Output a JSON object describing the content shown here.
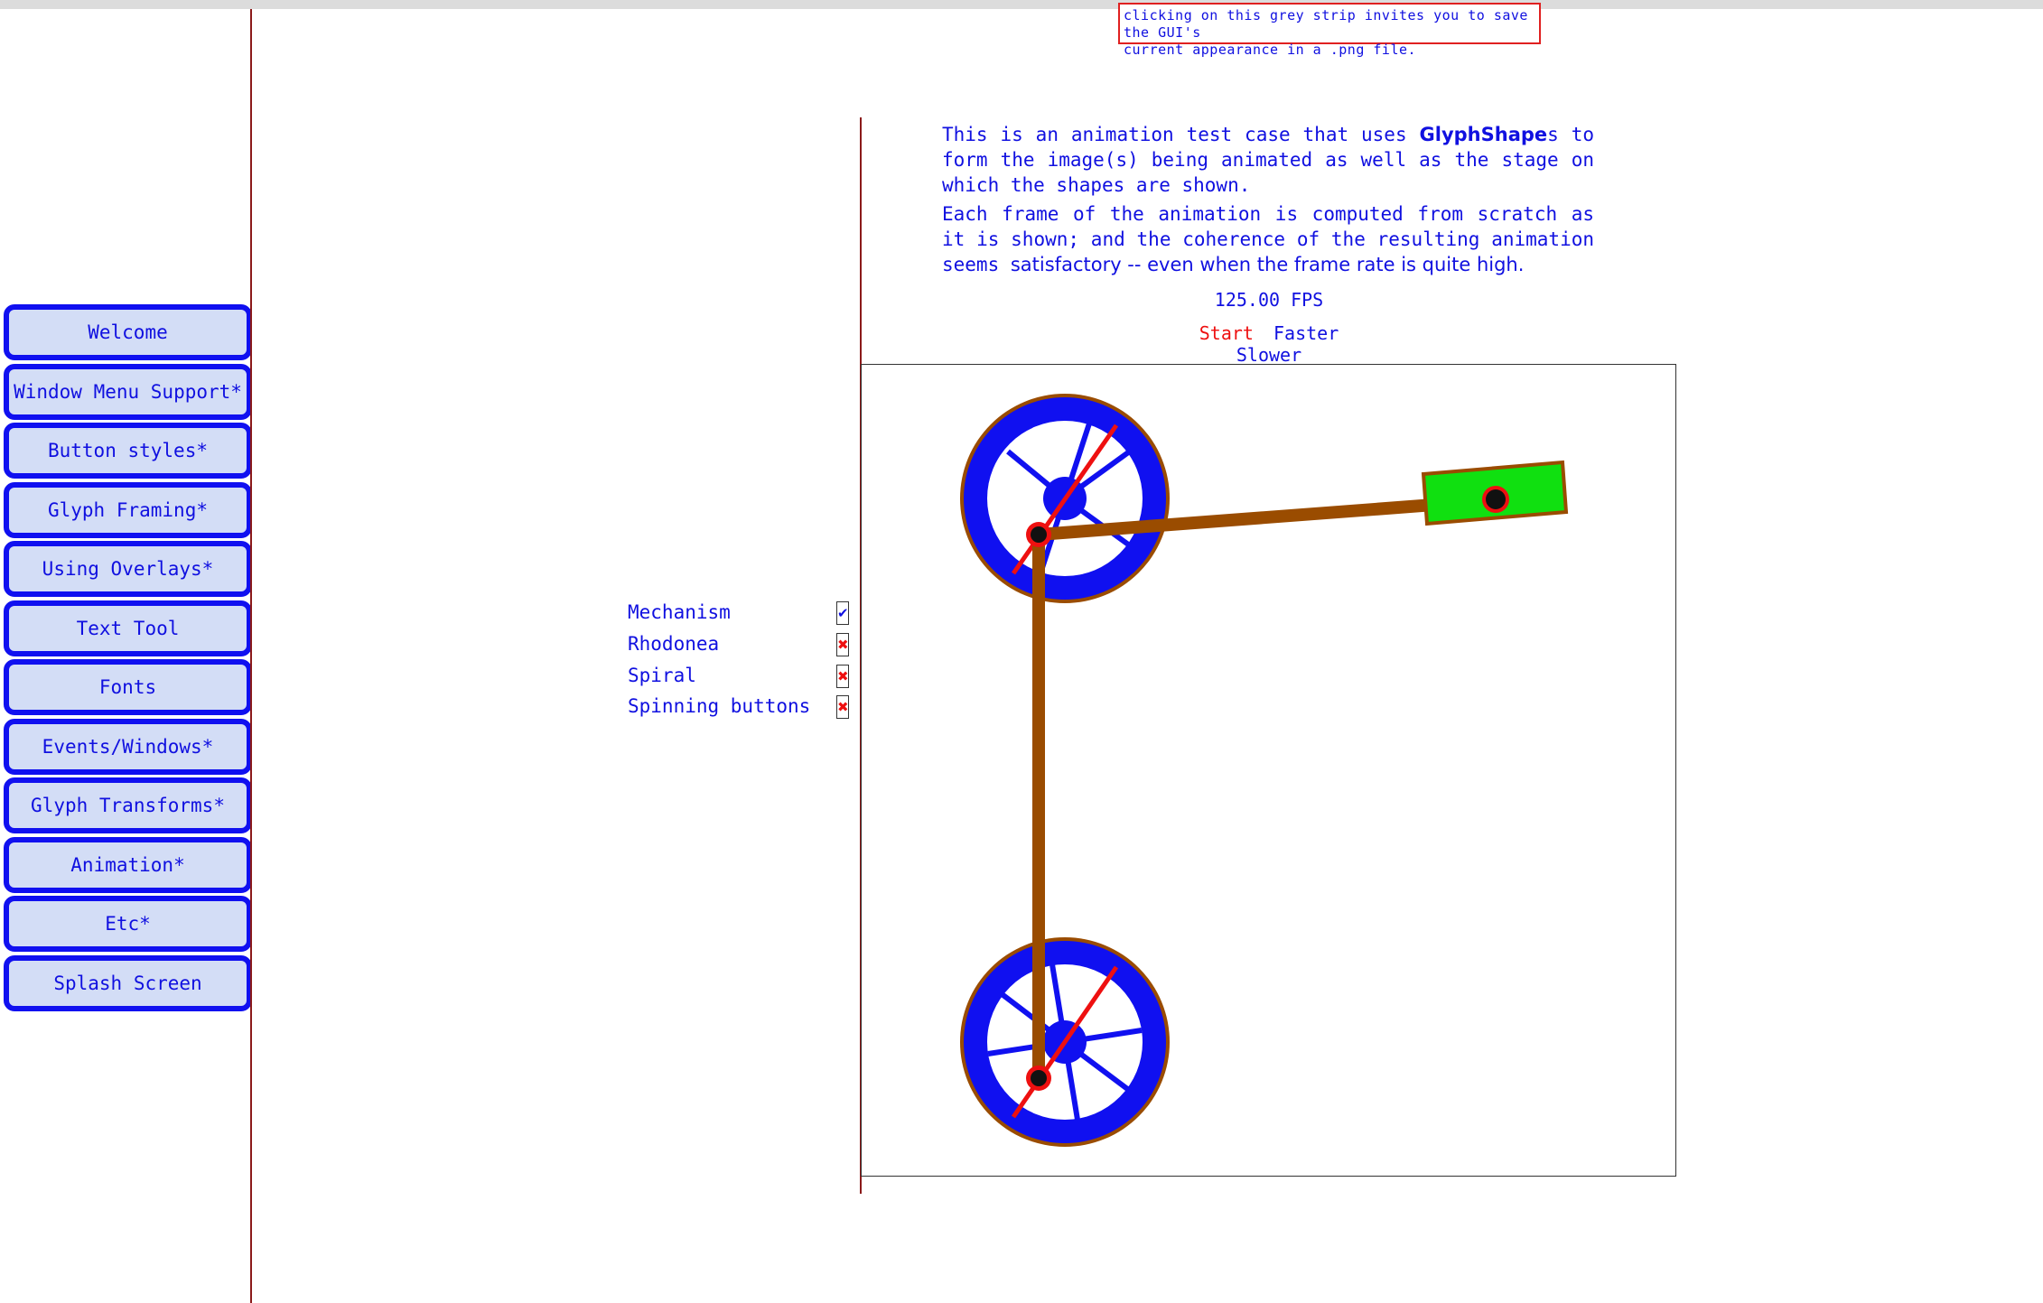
{
  "tooltip": {
    "line1": "clicking on this grey strip invites you to save the GUI's",
    "line2": "current appearance in a .png file."
  },
  "sidebar": {
    "items": [
      {
        "label": "Welcome"
      },
      {
        "label": "Window Menu Support*"
      },
      {
        "label": "Button styles*"
      },
      {
        "label": "Glyph Framing*"
      },
      {
        "label": "Using Overlays*"
      },
      {
        "label": "Text Tool"
      },
      {
        "label": "Fonts"
      },
      {
        "label": "Events/Windows*"
      },
      {
        "label": "Glyph Transforms*"
      },
      {
        "label": "Animation*"
      },
      {
        "label": "Etc*"
      },
      {
        "label": "Splash Screen"
      }
    ]
  },
  "description": {
    "p1_pre": "This is an animation test case that uses ",
    "p1_bold": "GlyphShape",
    "p1_post": "s to form the image(s) being animated as well as the stage on which the shapes are shown.",
    "p2_pre": "Each frame of the animation is computed from scratch as it is shown; and the coherence of the resulting animation seems ",
    "p2_prop": "satisfactory -- even when the frame rate is quite high."
  },
  "fps": "125.00 FPS",
  "controls": {
    "start": "Start",
    "faster": "Faster",
    "slower": "Slower"
  },
  "options": [
    {
      "label": "Mechanism",
      "checked": true,
      "mark": "✔"
    },
    {
      "label": "Rhodonea",
      "checked": false,
      "mark": "✖"
    },
    {
      "label": "Spiral",
      "checked": false,
      "mark": "✖"
    },
    {
      "label": "Spinning buttons",
      "checked": false,
      "mark": "✖"
    }
  ],
  "colors": {
    "accent": "#1010e0",
    "button_fill": "#d3ddf6",
    "button_border": "#1010f0",
    "divider": "#8b1a1a",
    "wheel_blue": "#1010f0",
    "rod_brown": "#9a4c00",
    "crank_red": "#ee1010",
    "slider_green": "#10e010",
    "start_red": "#ee1010"
  }
}
